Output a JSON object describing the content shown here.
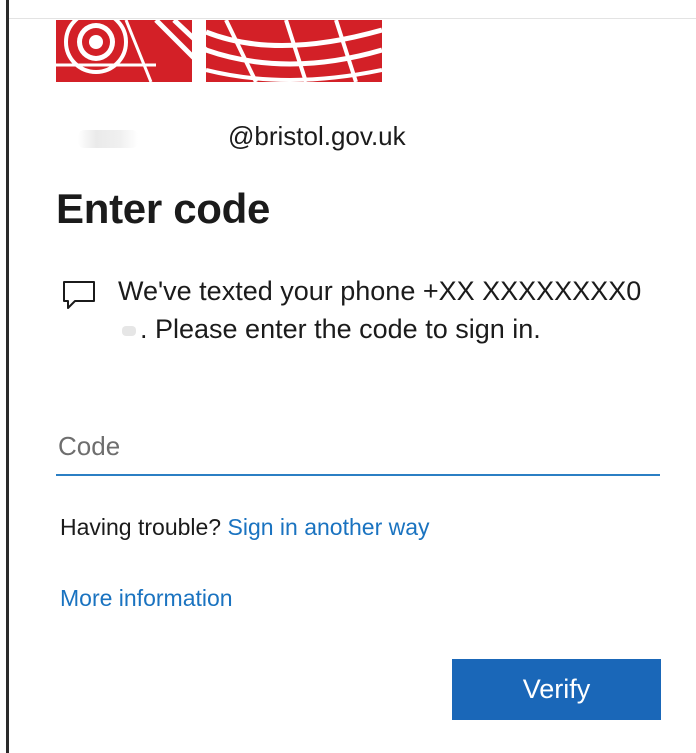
{
  "account": {
    "email": "@bristol.gov.uk"
  },
  "page": {
    "title": "Enter code"
  },
  "message": {
    "icon": "message-icon",
    "text_before": "We've texted your phone +XX XXXXXXXX0",
    "text_after": ". Please enter the code to sign in."
  },
  "code_input": {
    "value": "",
    "placeholder": "Code"
  },
  "trouble": {
    "prefix": "Having trouble? ",
    "link_label": "Sign in another way"
  },
  "more_info": {
    "label": "More information"
  },
  "verify_button": {
    "label": "Verify"
  },
  "colors": {
    "accent": "#1a67b8",
    "link": "#1a73c0",
    "logo_red": "#d32027"
  }
}
